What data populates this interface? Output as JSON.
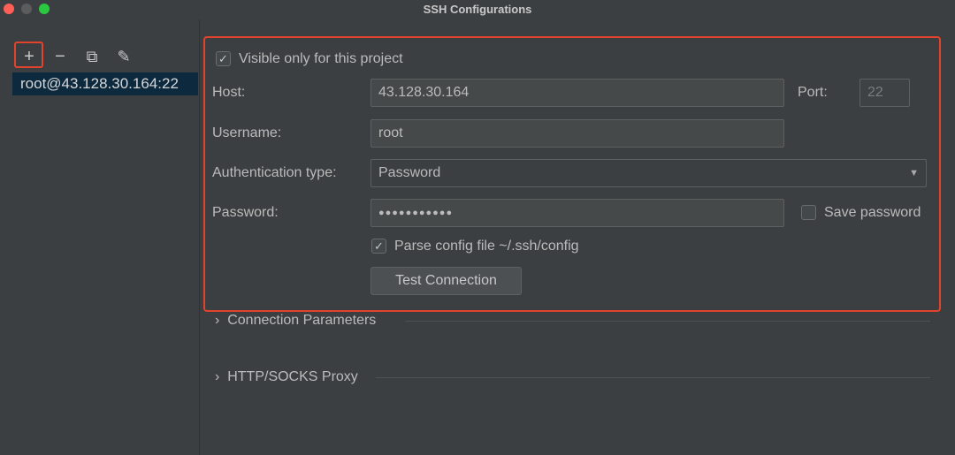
{
  "window": {
    "title": "SSH Configurations"
  },
  "toolbar": {
    "add": "+",
    "remove": "−",
    "copy": "⧉",
    "edit": "✎"
  },
  "sidebar": {
    "items": [
      {
        "label": "root@43.128.30.164:22"
      }
    ]
  },
  "form": {
    "visible_only": {
      "label": "Visible only for this project",
      "checked": true
    },
    "host": {
      "label": "Host:",
      "value": "43.128.30.164"
    },
    "port": {
      "label": "Port:",
      "value": "22"
    },
    "username": {
      "label": "Username:",
      "value": "root"
    },
    "auth": {
      "label": "Authentication type:",
      "value": "Password"
    },
    "password": {
      "label": "Password:",
      "value": "●●●●●●●●●●●"
    },
    "save_password": {
      "label": "Save password",
      "checked": false
    },
    "parse_config": {
      "label": "Parse config file ~/.ssh/config",
      "checked": true
    },
    "test_button": "Test Connection"
  },
  "sections": [
    {
      "label": "Connection Parameters"
    },
    {
      "label": "HTTP/SOCKS Proxy"
    }
  ],
  "colors": {
    "highlight": "#e2432a",
    "selection": "#0d293e",
    "background": "#3c3f41"
  }
}
